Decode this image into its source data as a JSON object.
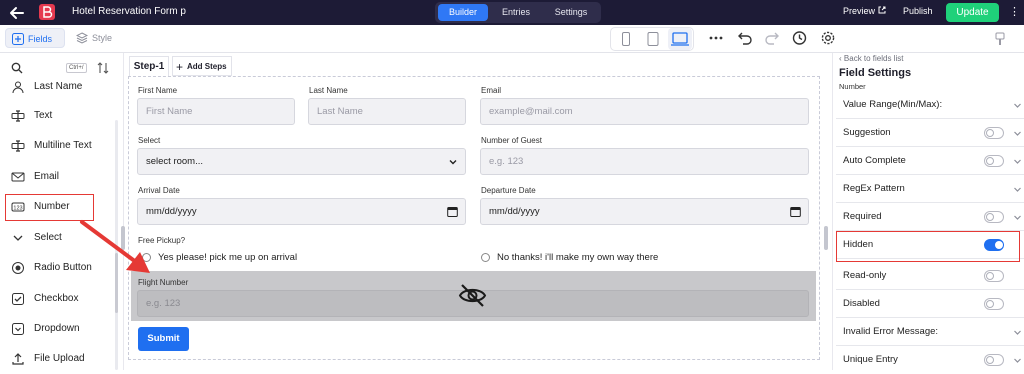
{
  "topbar": {
    "title": "Hotel Reservation Form p",
    "tabs": [
      {
        "label": "Builder",
        "active": true
      },
      {
        "label": "Entries",
        "active": false
      },
      {
        "label": "Settings",
        "active": false
      }
    ],
    "preview": "Preview",
    "publish": "Publish",
    "update": "Update"
  },
  "left_tabs": {
    "fields": "Fields",
    "style": "Style"
  },
  "search": {
    "placeholder": "",
    "shortcut": "Ctrl+/"
  },
  "field_items": [
    {
      "label": "Last Name",
      "icon": "person-icon"
    },
    {
      "label": "Text",
      "icon": "text-cursor-icon"
    },
    {
      "label": "Multiline Text",
      "icon": "text-cursor-icon"
    },
    {
      "label": "Email",
      "icon": "mail-icon"
    },
    {
      "label": "Number",
      "icon": "number-icon"
    },
    {
      "label": "Select",
      "icon": "chevron-down-icon"
    },
    {
      "label": "Radio Button",
      "icon": "radio-icon"
    },
    {
      "label": "Checkbox",
      "icon": "checkbox-icon"
    },
    {
      "label": "Dropdown",
      "icon": "dropdown-icon"
    },
    {
      "label": "File Upload",
      "icon": "upload-icon"
    }
  ],
  "canvas": {
    "step_tab": "Step-1",
    "add_steps": "Add Steps",
    "form": {
      "first_name": {
        "label": "First Name",
        "placeholder": "First Name"
      },
      "last_name": {
        "label": "Last Name",
        "placeholder": "Last Name"
      },
      "email": {
        "label": "Email",
        "placeholder": "example@mail.com"
      },
      "select": {
        "label": "Select",
        "value": "select room..."
      },
      "guests": {
        "label": "Number of Guest",
        "placeholder": "e.g. 123"
      },
      "arrival": {
        "label": "Arrival Date",
        "value": "mm/dd/yyyy"
      },
      "departure": {
        "label": "Departure Date",
        "value": "mm/dd/yyyy"
      },
      "pickup": {
        "label": "Free Pickup?",
        "options": [
          "Yes please! pick me up on arrival",
          "No thanks! i'll make my own way there"
        ]
      },
      "flight": {
        "label": "Flight Number",
        "placeholder": "e.g. 123"
      },
      "submit": "Submit"
    }
  },
  "settings": {
    "back": "Back to fields list",
    "title": "Field Settings",
    "subtitle": "Number",
    "rows": [
      {
        "label": "Value Range(Min/Max):",
        "toggle": null,
        "chevron": true
      },
      {
        "label": "Suggestion",
        "toggle": "off",
        "chevron": true
      },
      {
        "label": "Auto Complete",
        "toggle": "off",
        "chevron": true
      },
      {
        "label": "RegEx Pattern",
        "toggle": null,
        "chevron": true
      },
      {
        "label": "Required",
        "toggle": "off",
        "chevron": true
      },
      {
        "label": "Hidden",
        "toggle": "on",
        "chevron": false
      },
      {
        "label": "Read-only",
        "toggle": "off",
        "chevron": false
      },
      {
        "label": "Disabled",
        "toggle": "off",
        "chevron": false
      },
      {
        "label": "Invalid Error Message:",
        "toggle": null,
        "chevron": true
      },
      {
        "label": "Unique Entry",
        "toggle": "off",
        "chevron": true
      }
    ]
  },
  "colors": {
    "accent": "#1f6ff0",
    "update": "#1fd17a",
    "topbar": "#1d1b36",
    "highlight": "#e53935"
  }
}
